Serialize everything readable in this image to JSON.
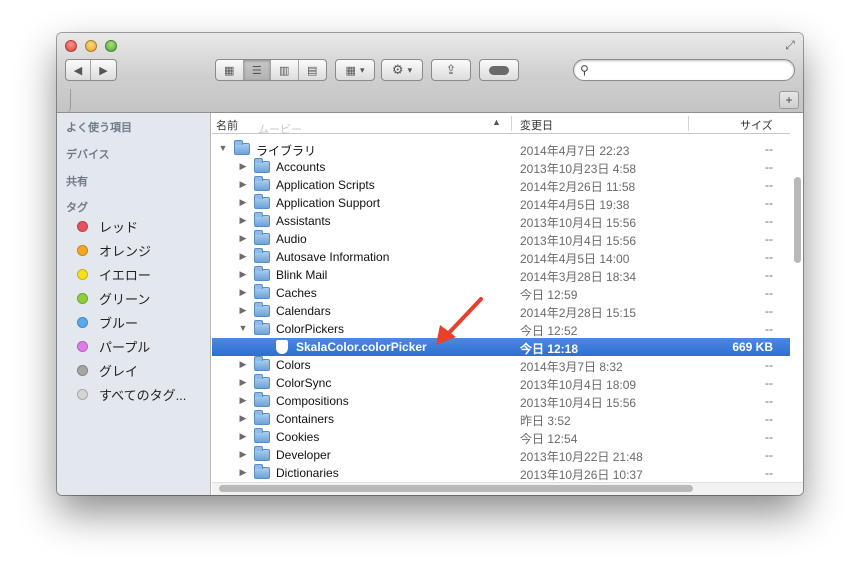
{
  "toolbar": {
    "back_icon": "◀",
    "forward_icon": "▶",
    "view_icon_glyph": "▦",
    "view_list_glyph": "☰",
    "view_column_glyph": "▥",
    "view_coverflow_glyph": "▤",
    "arrange_glyph": "▦",
    "action_glyph": "⚙",
    "dropdown_glyph": "▾",
    "share_glyph": "⇪",
    "tag_glyph": "⬬",
    "search_placeholder": "",
    "search_glyph": "⚲"
  },
  "tabbar": {
    "add_glyph": "+"
  },
  "sidebar": {
    "favorites": "よく使う項目",
    "devices": "デバイス",
    "shared": "共有",
    "tags_header": "タグ",
    "tags": [
      {
        "label": "レッド",
        "color": "#e8505b"
      },
      {
        "label": "オレンジ",
        "color": "#f5a623"
      },
      {
        "label": "イエロー",
        "color": "#f5e11b"
      },
      {
        "label": "グリーン",
        "color": "#8ccf3a"
      },
      {
        "label": "ブルー",
        "color": "#5aa9ef"
      },
      {
        "label": "パープル",
        "color": "#e07ae8"
      },
      {
        "label": "グレイ",
        "color": "#a6a6a6"
      },
      {
        "label": "すべてのタグ...",
        "color": "#d4d4d4"
      }
    ]
  },
  "columns": {
    "name": "名前",
    "sort_glyph": "▲",
    "modified": "変更日",
    "size": "サイズ"
  },
  "ghost": {
    "movies": "ムービー"
  },
  "rows": [
    {
      "name": "ライブラリ",
      "date": "2014年4月7日 22:23",
      "size": "--",
      "disc": "▼"
    },
    {
      "name": "Accounts",
      "date": "2013年10月23日 4:58",
      "size": "--",
      "disc": "▶"
    },
    {
      "name": "Application Scripts",
      "date": "2014年2月26日 11:58",
      "size": "--",
      "disc": "▶"
    },
    {
      "name": "Application Support",
      "date": "2014年4月5日 19:38",
      "size": "--",
      "disc": "▶"
    },
    {
      "name": "Assistants",
      "date": "2013年10月4日 15:56",
      "size": "--",
      "disc": "▶"
    },
    {
      "name": "Audio",
      "date": "2013年10月4日 15:56",
      "size": "--",
      "disc": "▶"
    },
    {
      "name": "Autosave Information",
      "date": "2014年4月5日 14:00",
      "size": "--",
      "disc": "▶"
    },
    {
      "name": "Blink Mail",
      "date": "2014年3月28日 18:34",
      "size": "--",
      "disc": "▶"
    },
    {
      "name": "Caches",
      "date": "今日 12:59",
      "size": "--",
      "disc": "▶"
    },
    {
      "name": "Calendars",
      "date": "2014年2月28日 15:15",
      "size": "--",
      "disc": "▶"
    },
    {
      "name": "ColorPickers",
      "date": "今日 12:52",
      "size": "--",
      "disc": "▼"
    },
    {
      "name": "SkalaColor.colorPicker",
      "date": "今日 12:18",
      "size": "669 KB",
      "disc": ""
    },
    {
      "name": "Colors",
      "date": "2014年3月7日 8:32",
      "size": "--",
      "disc": "▶"
    },
    {
      "name": "ColorSync",
      "date": "2013年10月4日 18:09",
      "size": "--",
      "disc": "▶"
    },
    {
      "name": "Compositions",
      "date": "2013年10月4日 15:56",
      "size": "--",
      "disc": "▶"
    },
    {
      "name": "Containers",
      "date": "昨日 3:52",
      "size": "--",
      "disc": "▶"
    },
    {
      "name": "Cookies",
      "date": "今日 12:54",
      "size": "--",
      "disc": "▶"
    },
    {
      "name": "Developer",
      "date": "2013年10月22日 21:48",
      "size": "--",
      "disc": "▶"
    },
    {
      "name": "Dictionaries",
      "date": "2013年10月26日 10:37",
      "size": "--",
      "disc": "▶"
    }
  ],
  "colors": {
    "selection": "#3375d6",
    "annotation_arrow": "#e8402a"
  }
}
